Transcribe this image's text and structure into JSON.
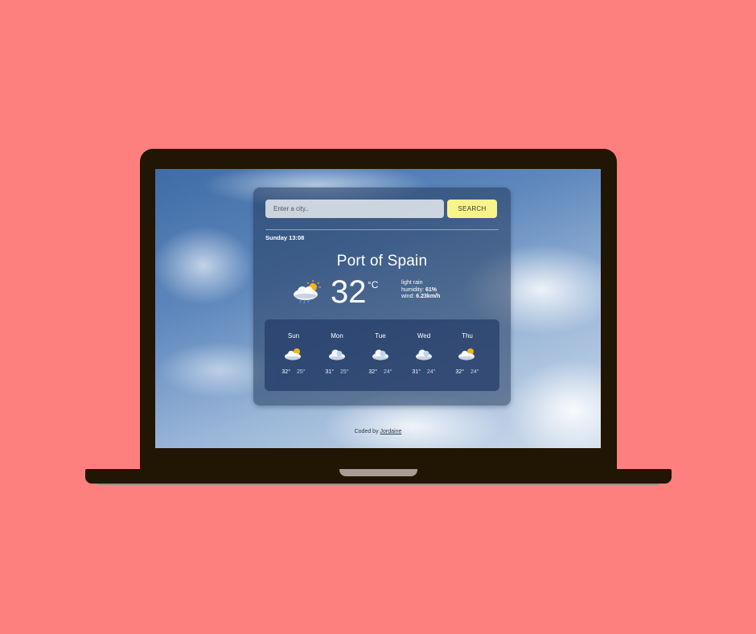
{
  "search": {
    "placeholder": "Enter a city..",
    "button_label": "SEARCH"
  },
  "current": {
    "datetime": "Sunday 13:08",
    "city": "Port of Spain",
    "temperature": "32",
    "unit": "°C",
    "icon": "rain-cloud-sun-icon",
    "description": "light rain",
    "humidity_label": "humidity:",
    "humidity_value": "61%",
    "wind_label": "wind:",
    "wind_value": "6.23km/h"
  },
  "forecast": [
    {
      "day": "Sun",
      "high": "32°",
      "low": "25°",
      "icon": "cloud-sun-icon"
    },
    {
      "day": "Mon",
      "high": "31°",
      "low": "25°",
      "icon": "cloud-icon"
    },
    {
      "day": "Tue",
      "high": "32°",
      "low": "24°",
      "icon": "cloud-icon"
    },
    {
      "day": "Wed",
      "high": "31°",
      "low": "24°",
      "icon": "cloud-icon"
    },
    {
      "day": "Thu",
      "high": "32°",
      "low": "24°",
      "icon": "cloud-sun-icon"
    }
  ],
  "footer": {
    "prefix": "Coded by",
    "author": "Jordaine"
  },
  "colors": {
    "page_background": "#fd807e",
    "laptop_body": "#211503",
    "search_button": "#f8f48a"
  }
}
